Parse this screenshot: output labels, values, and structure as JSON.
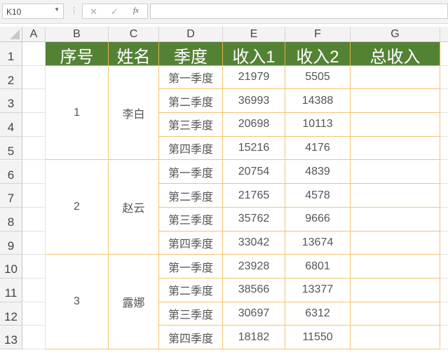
{
  "formula_bar": {
    "name_box": "K10",
    "cancel_icon": "✕",
    "enter_icon": "✓",
    "fx_label": "fx",
    "formula": ""
  },
  "columns": [
    "A",
    "B",
    "C",
    "D",
    "E",
    "F",
    "G"
  ],
  "rows": [
    "1",
    "2",
    "3",
    "4",
    "5",
    "6",
    "7",
    "8",
    "9",
    "10",
    "11",
    "12",
    "13"
  ],
  "headers": [
    "序号",
    "姓名",
    "季度",
    "收入1",
    "收入2",
    "总收入"
  ],
  "groups": [
    {
      "id": "1",
      "name": "李白",
      "quarters": [
        {
          "q": "第一季度",
          "r1": "21979",
          "r2": "5505"
        },
        {
          "q": "第二季度",
          "r1": "36993",
          "r2": "14388"
        },
        {
          "q": "第三季度",
          "r1": "20698",
          "r2": "10113"
        },
        {
          "q": "第四季度",
          "r1": "15216",
          "r2": "4176"
        }
      ]
    },
    {
      "id": "2",
      "name": "赵云",
      "quarters": [
        {
          "q": "第一季度",
          "r1": "20754",
          "r2": "4839"
        },
        {
          "q": "第二季度",
          "r1": "21765",
          "r2": "4578"
        },
        {
          "q": "第三季度",
          "r1": "35762",
          "r2": "9666"
        },
        {
          "q": "第四季度",
          "r1": "33042",
          "r2": "13674"
        }
      ]
    },
    {
      "id": "3",
      "name": "露娜",
      "quarters": [
        {
          "q": "第一季度",
          "r1": "23928",
          "r2": "6801"
        },
        {
          "q": "第二季度",
          "r1": "38566",
          "r2": "13377"
        },
        {
          "q": "第三季度",
          "r1": "30697",
          "r2": "6312"
        },
        {
          "q": "第四季度",
          "r1": "18182",
          "r2": "11550"
        }
      ]
    }
  ],
  "colors": {
    "header_bg": "#548235",
    "border": "#f4c46e"
  }
}
